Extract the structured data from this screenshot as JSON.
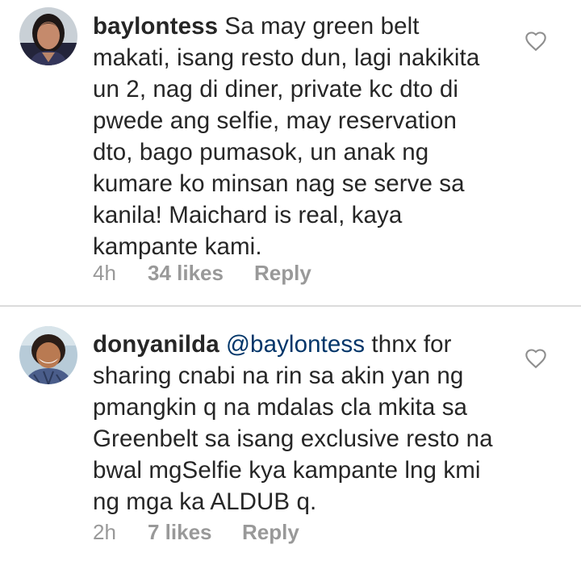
{
  "comments": [
    {
      "username": "baylontess",
      "mention": "",
      "lines": [
        "Sa may green belt",
        "makati, isang resto dun, lagi nakikita",
        "un 2, nag di diner, private kc dto di",
        "pwede ang selfie, may reservation",
        "dto, bago pumasok, un anak ng",
        "kumare ko minsan nag se serve sa",
        "kanila! Maichard is real, kaya",
        "kampante kami."
      ],
      "time": "4h",
      "likes": "34 likes",
      "reply": "Reply",
      "avatar_icon": "profile-photo",
      "like_icon": "heart-outline-icon"
    },
    {
      "username": "donyanilda",
      "mention": "@baylontess",
      "lines": [
        "thnx for",
        "sharing cnabi na rin sa akin yan ng",
        "pmangkin q na mdalas cla mkita sa",
        "Greenbelt sa isang exclusive resto na",
        "bwal mgSelfie kya kampante lng kmi",
        "ng mga ka ALDUB q."
      ],
      "time": "2h",
      "likes": "7 likes",
      "reply": "Reply",
      "avatar_icon": "profile-photo",
      "like_icon": "heart-outline-icon"
    }
  ],
  "colors": {
    "text": "#262626",
    "meta": "#999999",
    "mention": "#003569",
    "divider": "#dbdbdb"
  }
}
